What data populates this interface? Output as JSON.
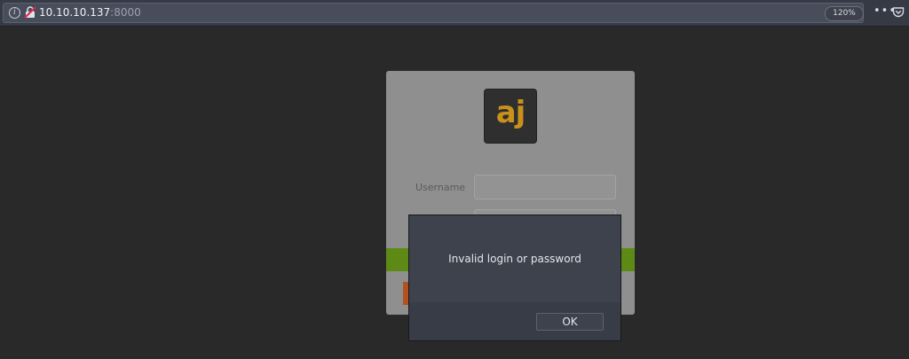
{
  "browser": {
    "url_host": "10.10.10.137",
    "url_port": ":8000",
    "zoom": "120%",
    "icons": {
      "info": "info-icon",
      "insecure": "insecure-connection-icon",
      "more": "more-options-icon",
      "pocket": "pocket-icon"
    }
  },
  "login": {
    "logo_text": "aj",
    "username_label": "Username",
    "accent_green": "#5c8a14",
    "logo_color": "#c9901c"
  },
  "dialog": {
    "message": "Invalid login or password",
    "ok_label": "OK"
  }
}
